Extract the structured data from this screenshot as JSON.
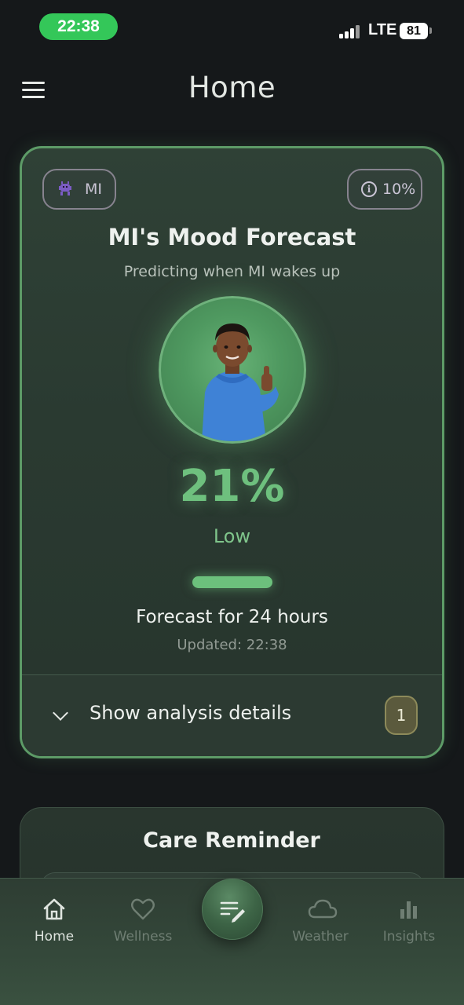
{
  "status_bar": {
    "time": "22:38",
    "network": "LTE",
    "battery": "81"
  },
  "header": {
    "title": "Home",
    "menu_icon": "hamburger-menu-icon"
  },
  "forecast_card": {
    "pet_chip": {
      "icon": "pet-icon",
      "label": "MI"
    },
    "info_chip": {
      "icon": "info-icon",
      "label": "10%"
    },
    "title": "MI's Mood Forecast",
    "subtitle": "Predicting when MI wakes up",
    "percentage": "21%",
    "level": "Low",
    "progress": 0.21,
    "forecast_span": "Forecast for 24 hours",
    "updated": "Updated: 22:38",
    "details_toggle": {
      "label": "Show analysis details",
      "icon": "chevron-down-icon",
      "badge": "1"
    },
    "accent_color": "#6ec07e"
  },
  "care_card": {
    "title": "Care Reminder"
  },
  "bottom_nav": {
    "items": [
      {
        "label": "Home",
        "icon": "home-icon",
        "active": true
      },
      {
        "label": "Wellness",
        "icon": "heart-icon",
        "active": false
      },
      {
        "label": "Weather",
        "icon": "cloud-icon",
        "active": false
      },
      {
        "label": "Insights",
        "icon": "bar-chart-icon",
        "active": false
      }
    ],
    "fab_icon": "edit-notes-icon"
  }
}
